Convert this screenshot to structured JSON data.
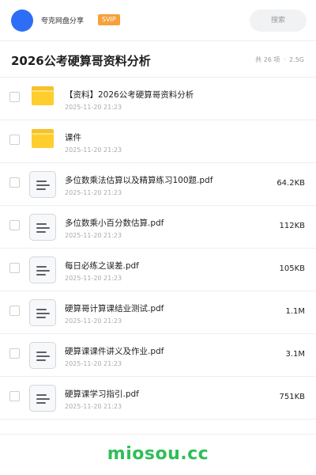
{
  "header": {
    "username": "夸克网盘分享",
    "badge": "SVIP",
    "search_placeholder": "搜索",
    "avatar_color": "#2e6df6",
    "badge_color": "#f6a13a"
  },
  "title_bar": {
    "title": "2026公考硬算哥资料分析",
    "count": "共 26 项",
    "separator": "·",
    "total_size": "2.5G"
  },
  "files": [
    {
      "type": "folder",
      "icon": "folder-icon",
      "name": "【资料】2026公考硬算哥资料分析",
      "date": "2025-11-20 21:23",
      "size": ""
    },
    {
      "type": "folder",
      "icon": "folder-icon",
      "name": "课件",
      "date": "2025-11-20 21:23",
      "size": ""
    },
    {
      "type": "file",
      "icon": "document-icon",
      "name": "多位数乘法估算以及精算练习100题.pdf",
      "date": "2025-11-20 21:23",
      "size": "64.2KB"
    },
    {
      "type": "file",
      "icon": "document-icon",
      "name": "多位数乘小百分数估算.pdf",
      "date": "2025-11-20 21:23",
      "size": "112KB"
    },
    {
      "type": "file",
      "icon": "document-icon",
      "name": "每日必练之误差.pdf",
      "date": "2025-11-20 21:23",
      "size": "105KB"
    },
    {
      "type": "file",
      "icon": "document-icon",
      "name": "硬算哥计算课结业测试.pdf",
      "date": "2025-11-20 21:23",
      "size": "1.1M"
    },
    {
      "type": "file",
      "icon": "document-icon",
      "name": "硬算课课件讲义及作业.pdf",
      "date": "2025-11-20 21:23",
      "size": "3.1M"
    },
    {
      "type": "file",
      "icon": "document-icon",
      "name": "硬算课学习指引.pdf",
      "date": "2025-11-20 21:23",
      "size": "751KB"
    }
  ],
  "footer": {
    "brand": "miosou.cc",
    "brand_color": "#2fbe58"
  }
}
